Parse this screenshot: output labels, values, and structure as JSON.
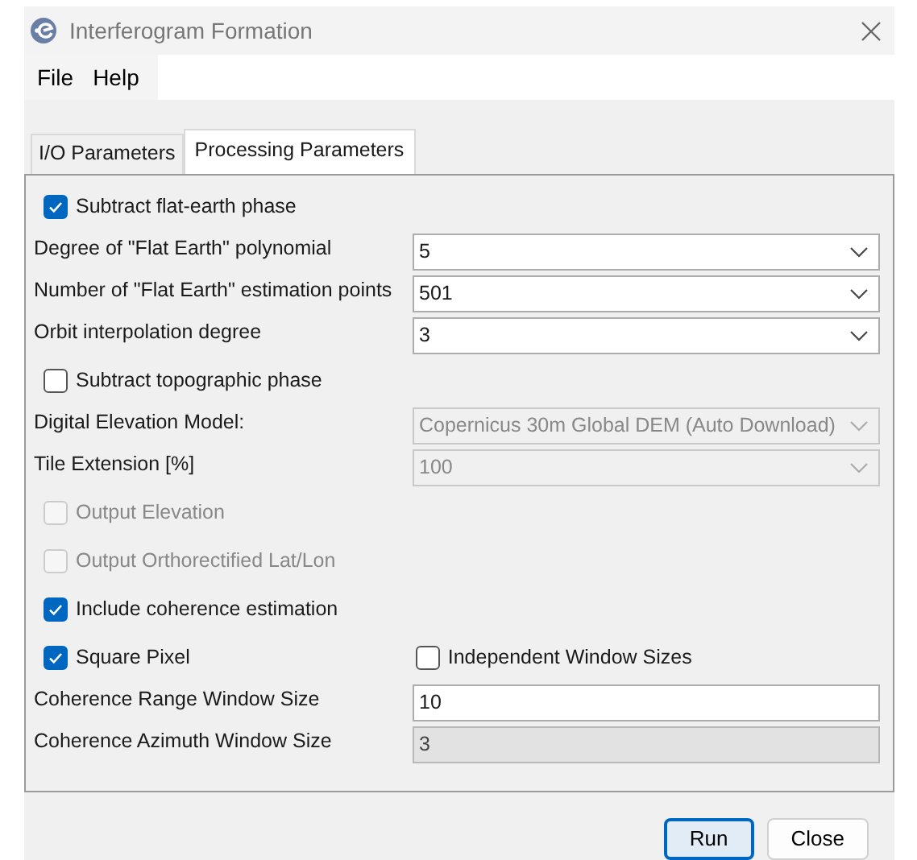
{
  "window": {
    "title": "Interferogram Formation"
  },
  "menu": [
    "File",
    "Help"
  ],
  "tabs": [
    {
      "label": "I/O Parameters",
      "selected": false
    },
    {
      "label": "Processing Parameters",
      "selected": true
    }
  ],
  "rows": [
    {
      "kind": "check",
      "items": [
        {
          "label": "Subtract flat-earth phase",
          "checked": true,
          "disabled": false
        }
      ]
    },
    {
      "kind": "select",
      "label": "Degree of \"Flat Earth\" polynomial",
      "value": "5",
      "disabled": false
    },
    {
      "kind": "select",
      "label": "Number of \"Flat Earth\" estimation points",
      "value": "501",
      "disabled": false
    },
    {
      "kind": "select",
      "label": "Orbit interpolation degree",
      "value": "3",
      "disabled": false
    },
    {
      "kind": "check",
      "items": [
        {
          "label": "Subtract topographic phase",
          "checked": false,
          "disabled": false
        }
      ]
    },
    {
      "kind": "select",
      "label": "Digital Elevation Model:",
      "value": "Copernicus 30m Global DEM (Auto Download)",
      "disabled": true
    },
    {
      "kind": "select",
      "label": "Tile Extension [%]",
      "value": "100",
      "disabled": true
    },
    {
      "kind": "check",
      "items": [
        {
          "label": "Output Elevation",
          "checked": false,
          "disabled": true
        }
      ]
    },
    {
      "kind": "check",
      "items": [
        {
          "label": "Output Orthorectified Lat/Lon",
          "checked": false,
          "disabled": true
        }
      ]
    },
    {
      "kind": "check",
      "items": [
        {
          "label": "Include coherence estimation",
          "checked": true,
          "disabled": false
        }
      ]
    },
    {
      "kind": "check",
      "items": [
        {
          "label": "Square Pixel",
          "checked": true,
          "disabled": false
        },
        {
          "label": "Independent Window Sizes",
          "checked": false,
          "disabled": false
        }
      ]
    },
    {
      "kind": "input",
      "label": "Coherence Range Window Size",
      "value": "10",
      "disabled": false
    },
    {
      "kind": "input",
      "label": "Coherence Azimuth Window Size",
      "value": "3",
      "disabled": true
    }
  ],
  "buttons": [
    {
      "label": "Run",
      "default": true
    },
    {
      "label": "Close",
      "default": false
    }
  ]
}
